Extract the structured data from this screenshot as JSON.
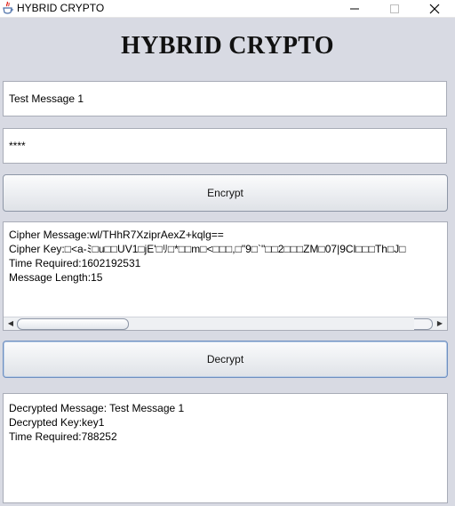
{
  "window": {
    "title": "HYBRID CRYPTO"
  },
  "header": {
    "title": "HYBRID CRYPTO"
  },
  "inputs": {
    "message": "Test Message 1",
    "key": "****"
  },
  "buttons": {
    "encrypt": "Encrypt",
    "decrypt": "Decrypt"
  },
  "encrypt_output": {
    "lines": [
      "Cipher Message:wl/THhR7XziprAexZ+kqlg==",
      "Cipher Key:□<a-ﾐ□u□□UV1□jE'□ﾘ□*□□m□<□□□,□\"9□`\"□□2□□□ZM□07|9Cl□□□Th□J□",
      "Time Required:1602192531",
      "Message Length:15"
    ]
  },
  "decrypt_output": {
    "lines": [
      "Decrypted Message: Test Message 1",
      "Decrypted Key:key1",
      "Time Required:788252"
    ]
  },
  "icons": {
    "app": "java-cup-icon",
    "minimize": "minimize-icon",
    "maximize": "maximize-icon",
    "close": "close-icon"
  }
}
